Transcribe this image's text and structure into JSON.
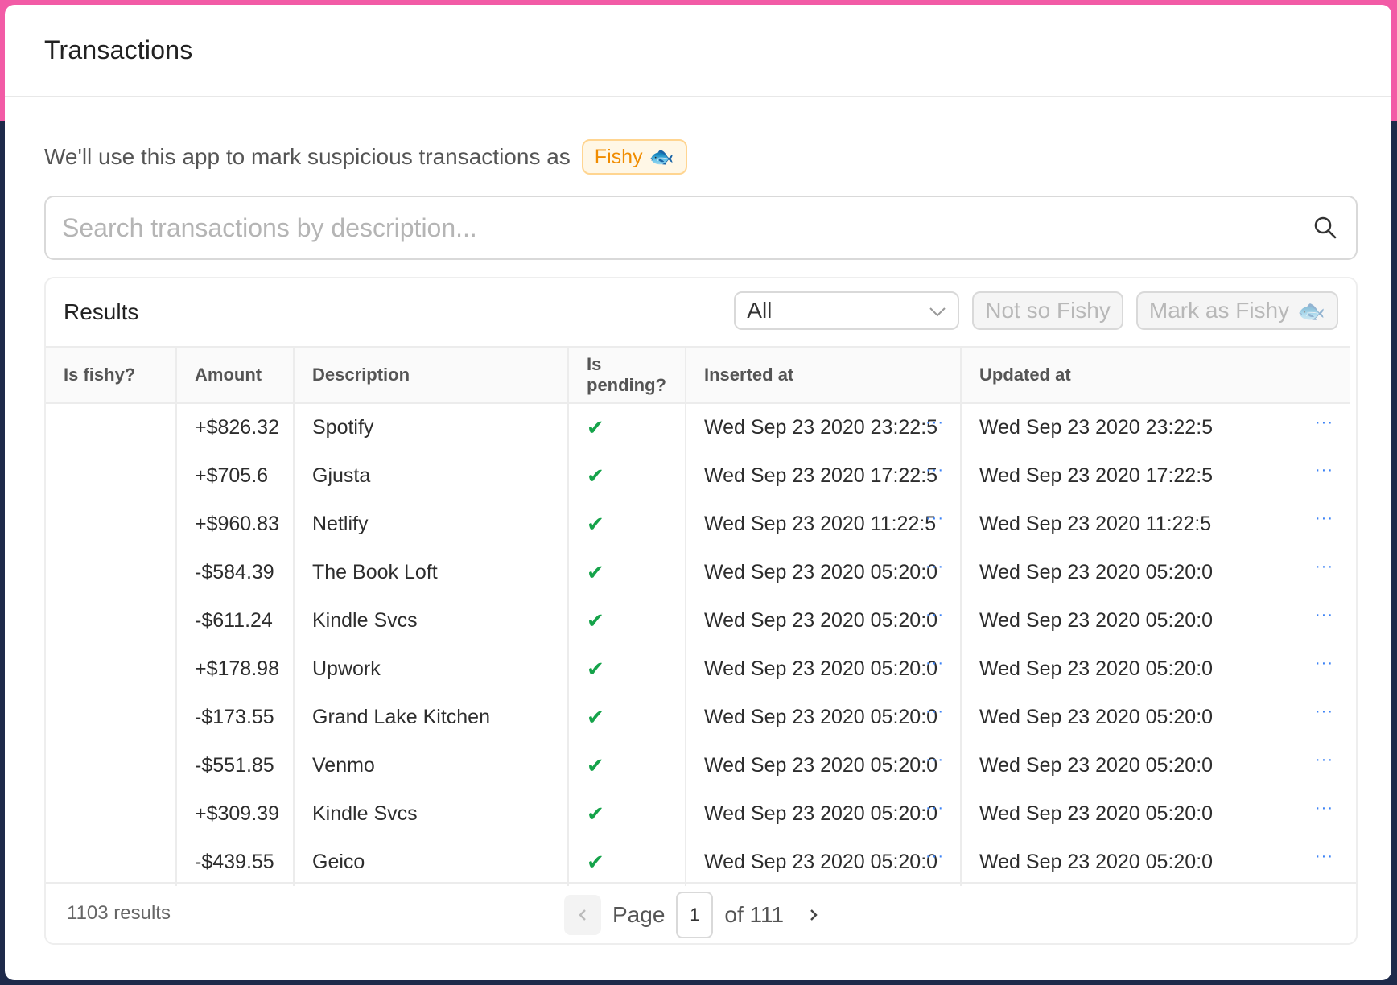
{
  "header": {
    "title": "Transactions"
  },
  "intro": {
    "text": "We'll use this app to mark suspicious transactions as",
    "tag_label": "Fishy",
    "tag_emoji": "🐟"
  },
  "search": {
    "placeholder": "Search transactions by description..."
  },
  "results": {
    "title": "Results",
    "filter_value": "All",
    "not_fishy_label": "Not so Fishy",
    "mark_fishy_label": "Mark as Fishy",
    "mark_fishy_emoji": "🐟"
  },
  "table": {
    "columns": [
      "Is fishy?",
      "Amount",
      "Description",
      "Is pending?",
      "Inserted at",
      "Updated at"
    ],
    "rows": [
      {
        "amount": "+$826.32",
        "description": "Spotify",
        "pending": "✔",
        "inserted": "Wed Sep 23 2020 23:22:5",
        "updated": "Wed Sep 23 2020 23:22:5"
      },
      {
        "amount": "+$705.6",
        "description": "Gjusta",
        "pending": "✔",
        "inserted": "Wed Sep 23 2020 17:22:5",
        "updated": "Wed Sep 23 2020 17:22:5"
      },
      {
        "amount": "+$960.83",
        "description": "Netlify",
        "pending": "✔",
        "inserted": "Wed Sep 23 2020 11:22:5",
        "updated": "Wed Sep 23 2020 11:22:5"
      },
      {
        "amount": "-$584.39",
        "description": "The Book Loft",
        "pending": "✔",
        "inserted": "Wed Sep 23 2020 05:20:0",
        "updated": "Wed Sep 23 2020 05:20:0"
      },
      {
        "amount": "-$611.24",
        "description": "Kindle Svcs",
        "pending": "✔",
        "inserted": "Wed Sep 23 2020 05:20:0",
        "updated": "Wed Sep 23 2020 05:20:0"
      },
      {
        "amount": "+$178.98",
        "description": "Upwork",
        "pending": "✔",
        "inserted": "Wed Sep 23 2020 05:20:0",
        "updated": "Wed Sep 23 2020 05:20:0"
      },
      {
        "amount": "-$173.55",
        "description": "Grand Lake Kitchen",
        "pending": "✔",
        "inserted": "Wed Sep 23 2020 05:20:0",
        "updated": "Wed Sep 23 2020 05:20:0"
      },
      {
        "amount": "-$551.85",
        "description": "Venmo",
        "pending": "✔",
        "inserted": "Wed Sep 23 2020 05:20:0",
        "updated": "Wed Sep 23 2020 05:20:0"
      },
      {
        "amount": "+$309.39",
        "description": "Kindle Svcs",
        "pending": "✔",
        "inserted": "Wed Sep 23 2020 05:20:0",
        "updated": "Wed Sep 23 2020 05:20:0"
      },
      {
        "amount": "-$439.55",
        "description": "Geico",
        "pending": "✔",
        "inserted": "Wed Sep 23 2020 05:20:0",
        "updated": "Wed Sep 23 2020 05:20:0"
      }
    ],
    "more_glyph": "···"
  },
  "footer": {
    "results_count": "1103 results",
    "page_label": "Page",
    "page_value": "1",
    "of_label": "of 111"
  },
  "colors": {
    "accent_pink": "#f25ba6",
    "backdrop_navy": "#1e2a4a",
    "fishy_orange": "#f08c00",
    "check_green": "#15a34a",
    "link_blue": "#3b82f6"
  }
}
